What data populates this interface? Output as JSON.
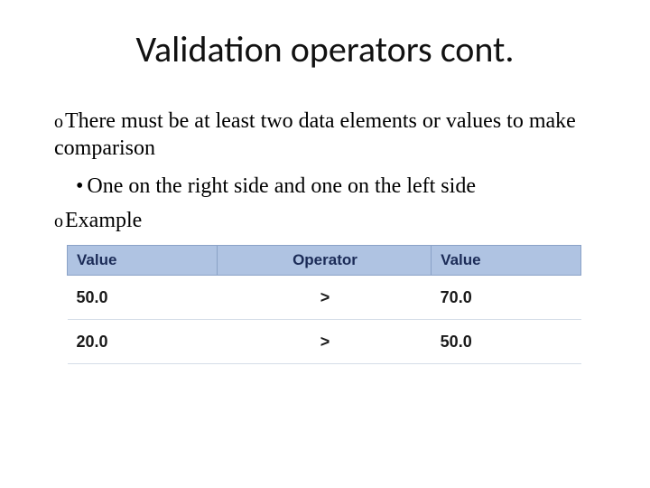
{
  "title": "Validation operators cont.",
  "bullets": {
    "concept": "There must be at least two data elements  or values to make comparison",
    "sub": "One on the right side and one on the left side",
    "example_label": "Example"
  },
  "table": {
    "headers": {
      "left": "Value",
      "mid": "Operator",
      "right": "Value"
    },
    "rows": [
      {
        "left": "50.0",
        "op": ">",
        "right": "70.0"
      },
      {
        "left": "20.0",
        "op": ">",
        "right": "50.0"
      }
    ]
  }
}
